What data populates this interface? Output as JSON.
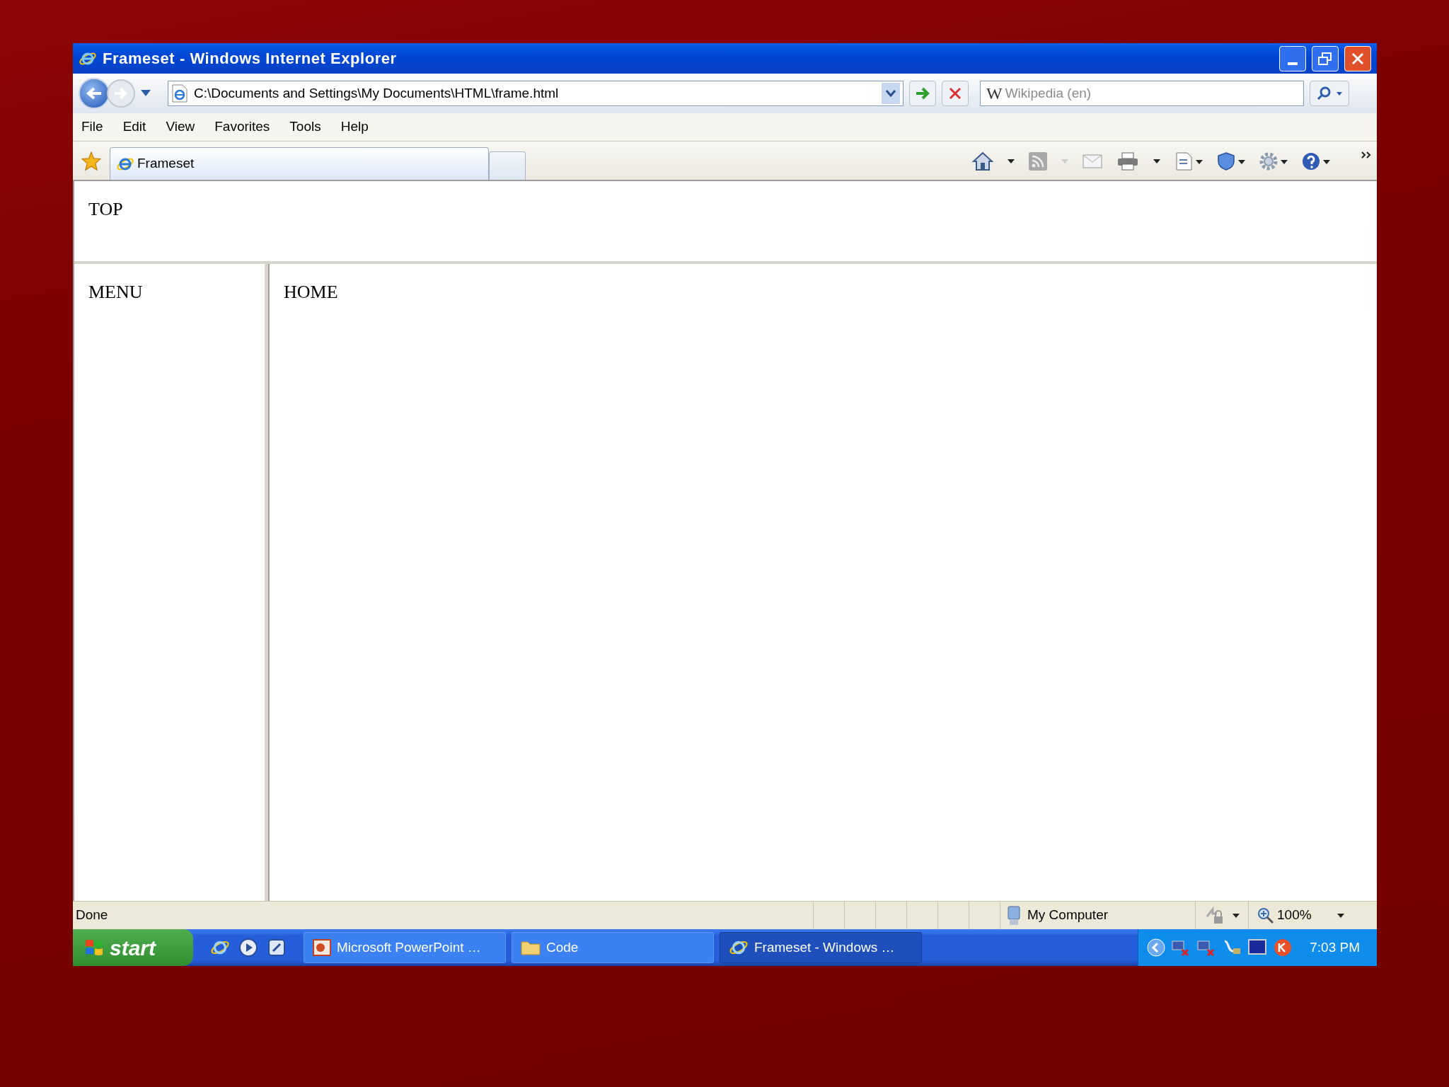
{
  "window": {
    "title": "Frameset - Windows Internet Explorer"
  },
  "address_bar": {
    "value": "C:\\Documents and Settings\\My Documents\\HTML\\frame.html"
  },
  "search": {
    "engine_mark": "W",
    "placeholder": "Wikipedia (en)"
  },
  "menu": [
    "File",
    "Edit",
    "View",
    "Favorites",
    "Tools",
    "Help"
  ],
  "tabs": [
    {
      "label": "Frameset",
      "selected": true
    },
    {
      "selected": false
    }
  ],
  "frames": {
    "top": "TOP",
    "menu": "MENU",
    "main": "HOME"
  },
  "status_bar": {
    "text": "Done",
    "zone": "My Computer",
    "zoom": "100%"
  },
  "taskbar": {
    "start": "start",
    "buttons": [
      {
        "label": "Microsoft PowerPoint …",
        "kind": "slides",
        "selected": false
      },
      {
        "label": "Code",
        "kind": "folder",
        "selected": false
      },
      {
        "label": "Frameset - Windows …",
        "kind": "browser",
        "selected": true
      }
    ],
    "clock": "7:03 PM"
  }
}
